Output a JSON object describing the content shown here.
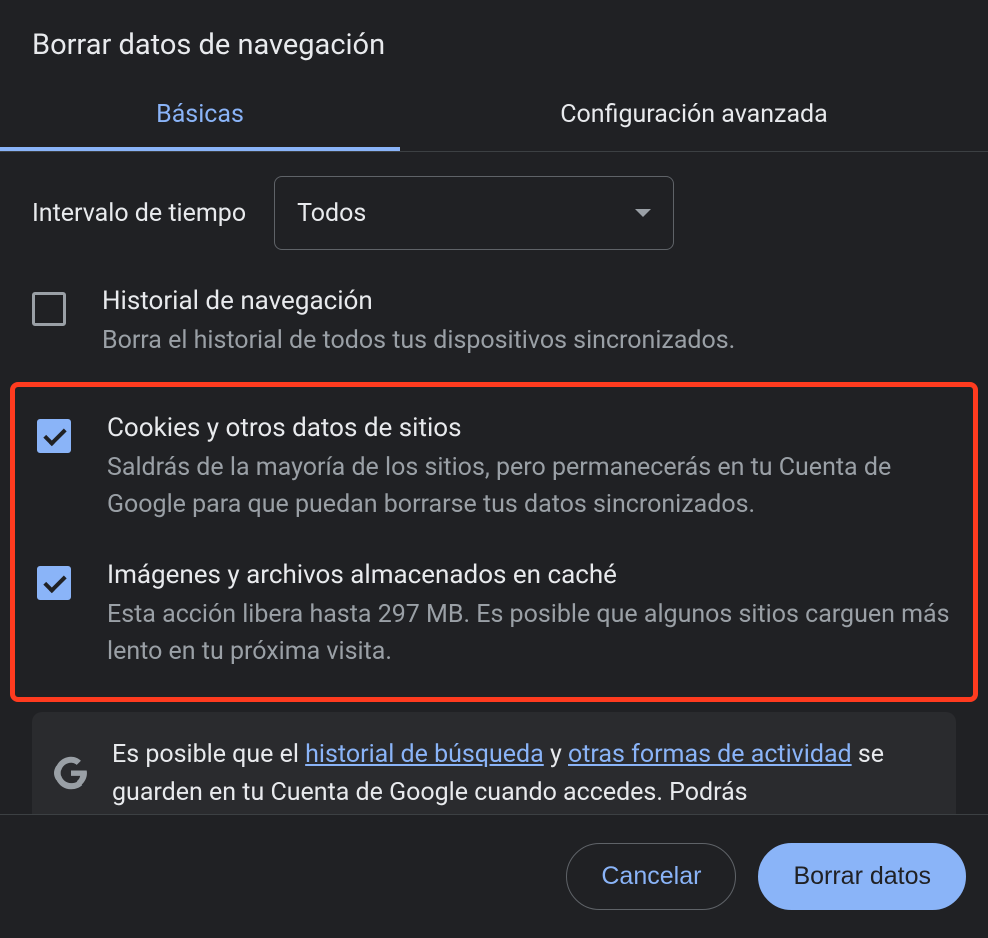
{
  "title": "Borrar datos de navegación",
  "tabs": {
    "basic": "Básicas",
    "advanced": "Configuración avanzada"
  },
  "timeRange": {
    "label": "Intervalo de tiempo",
    "value": "Todos"
  },
  "options": {
    "history": {
      "title": "Historial de navegación",
      "desc": "Borra el historial de todos tus dispositivos sincronizados.",
      "checked": false
    },
    "cookies": {
      "title": "Cookies y otros datos de sitios",
      "desc": "Saldrás de la mayoría de los sitios, pero permanecerás en tu Cuenta de Google para que puedan borrarse tus datos sincronizados.",
      "checked": true
    },
    "cache": {
      "title": "Imágenes y archivos almacenados en caché",
      "desc": "Esta acción libera hasta 297 MB. Es posible que algunos sitios carguen más lento en tu próxima visita.",
      "checked": true
    }
  },
  "info": {
    "prefix": "Es posible que el ",
    "link1": "historial de búsqueda",
    "mid": " y ",
    "link2": "otras formas de actividad",
    "suffix": " se guarden en tu Cuenta de Google cuando accedes. Podrás"
  },
  "buttons": {
    "cancel": "Cancelar",
    "confirm": "Borrar datos"
  }
}
